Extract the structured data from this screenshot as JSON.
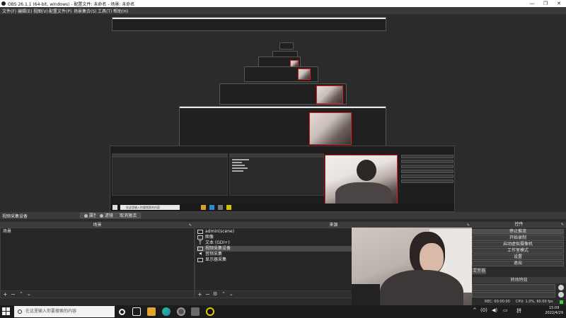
{
  "window": {
    "title": "OBS 26.1.1 (64-bit, windows) - 配置文件: 未命名 - 场景: 未命名",
    "controls": [
      "—",
      "❐",
      "✕"
    ]
  },
  "menu": [
    "文件(F)",
    "编辑(E)",
    "视图(V)",
    "配置文件(P)",
    "场景集合(S)",
    "工具(T)",
    "帮助(H)"
  ],
  "source_toolbar": {
    "selected_source": "视频采集设备",
    "properties_label": "属性",
    "filters_label": "滤镜",
    "deactivate_label": "取消激活"
  },
  "scenes_panel": {
    "title": "场景",
    "items": [
      "场景"
    ]
  },
  "sources_panel": {
    "title": "来源",
    "items": [
      {
        "icon": "window-capture-icon",
        "name": "admin(scene)"
      },
      {
        "icon": "image-icon",
        "name": "图像"
      },
      {
        "icon": "text-icon",
        "name": "文本 (GDI+)"
      },
      {
        "icon": "camera-icon",
        "name": "视频采集设备"
      },
      {
        "icon": "speaker-icon",
        "name": "音频采集"
      },
      {
        "icon": "monitor-icon",
        "name": "显示器采集"
      }
    ]
  },
  "controls_panel": {
    "title": "控件",
    "buttons": [
      "停止推流",
      "开始录制",
      "启动虚拟摄像机",
      "工作室模式",
      "设置",
      "退出"
    ]
  },
  "transitions_panel": {
    "tab": "混音器",
    "title": "转场特效"
  },
  "status_bar": {
    "rec": "REC: 00:00:00",
    "cpu": "CPU: 1.0%, 60.00 fps"
  },
  "taskbar": {
    "search_placeholder": "在这里输入你要搜索的内容",
    "ime": "拼",
    "time": "15:09",
    "date": "2022/4/29",
    "network": "(0)"
  },
  "nested_preview": {
    "search_placeholder": "在这里输入你要搜索的内容"
  },
  "colors": {
    "background": "#2b2b2b",
    "panel": "#272727",
    "panel_header": "#3b3b3b",
    "selection": "#4a4a4a",
    "preview_border": "#e02020",
    "taskbar": "#1c1c1c"
  }
}
